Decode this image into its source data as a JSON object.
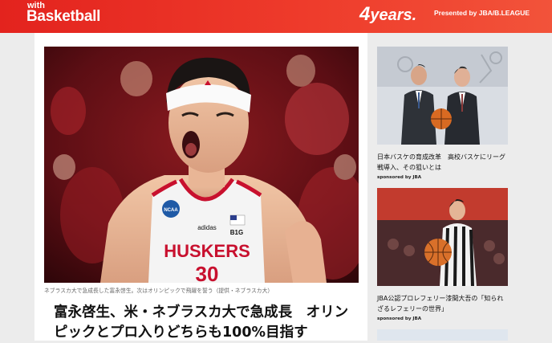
{
  "header": {
    "brand_small": "with",
    "brand_big": "Basketball",
    "logo_four": "4",
    "logo_text": "years.",
    "presented": "Presented by JBA/B.LEAGUE"
  },
  "article": {
    "caption": "ネブラスカ大で急成長した富永啓生。次はオリンピックで飛躍を誓う（提供・ネブラスカ大）",
    "headline": "富永啓生、米・ネブラスカ大で急成長　オリンピックとプロ入りどちらも100%目指す",
    "jersey": {
      "team": "HUSKERS",
      "number": "30",
      "badge": "B1G",
      "ncaa": "NCAA",
      "brand": "adidas"
    }
  },
  "sidebar": {
    "cards": [
      {
        "title": "日本バスケの育成改革　高校バスケにリーグ戦導入、その狙いとは",
        "sponsor": "sponsored by JBA"
      },
      {
        "title": "JBA公認プロレフェリー漆間大吾の「知られざるレフェリーの世界」",
        "sponsor": "sponsored by JBA"
      }
    ]
  },
  "colors": {
    "header_red": "#e3231e",
    "jersey_red": "#c8102e"
  }
}
